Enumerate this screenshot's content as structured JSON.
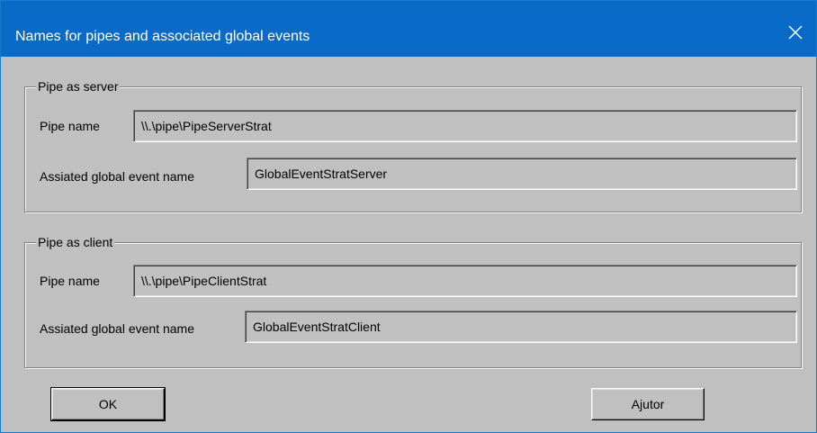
{
  "window": {
    "title": "Names for pipes and associated global events",
    "close_icon": "close-icon"
  },
  "server_group": {
    "legend": "Pipe as server",
    "pipe_name_label": "Pipe name",
    "pipe_name_value": "\\\\.\\pipe\\PipeServerStrat",
    "event_name_label": "Assiated global event name",
    "event_name_value": "GlobalEventStratServer"
  },
  "client_group": {
    "legend": "Pipe as client",
    "pipe_name_label": "Pipe name",
    "pipe_name_value": "\\\\.\\pipe\\PipeClientStrat",
    "event_name_label": "Assiated global event name",
    "event_name_value": "GlobalEventStratClient"
  },
  "buttons": {
    "ok_label": "OK",
    "help_label": "Ajutor"
  },
  "colors": {
    "titlebar": "#0a6ac8",
    "dialog_bg": "#c0c0c0"
  }
}
